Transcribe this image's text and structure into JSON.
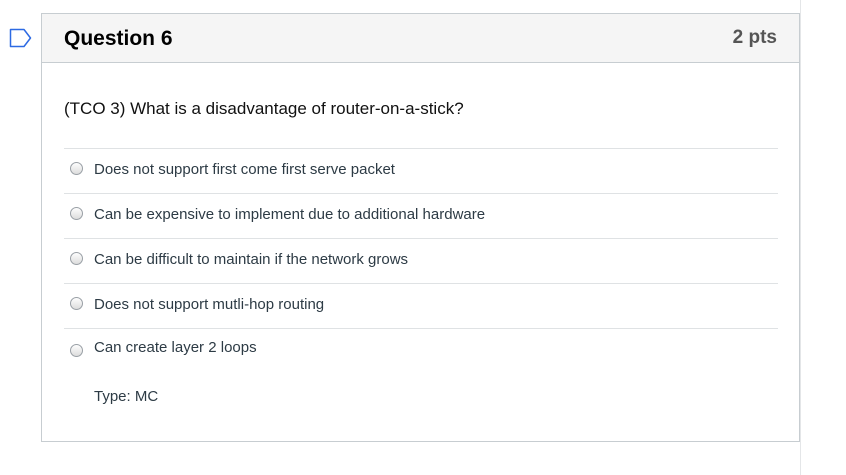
{
  "question": {
    "title": "Question 6",
    "points": "2 pts",
    "text": "(TCO 3) What is a disadvantage of router-on-a-stick?",
    "type_label": "Type: MC",
    "flag_icon": "flag-outline-icon",
    "answers": [
      {
        "label": "Does not support first come first serve packet",
        "selected": false
      },
      {
        "label": "Can be expensive to implement due to additional hardware",
        "selected": false
      },
      {
        "label": "Can be difficult to maintain if the network grows",
        "selected": false
      },
      {
        "label": "Does not support mutli-hop routing",
        "selected": false
      },
      {
        "label": "Can create layer 2 loops",
        "selected": false
      }
    ]
  },
  "colors": {
    "flag_accent": "#2d6ae3",
    "header_bg": "#f5f5f5",
    "border": "#c7cdd1"
  }
}
